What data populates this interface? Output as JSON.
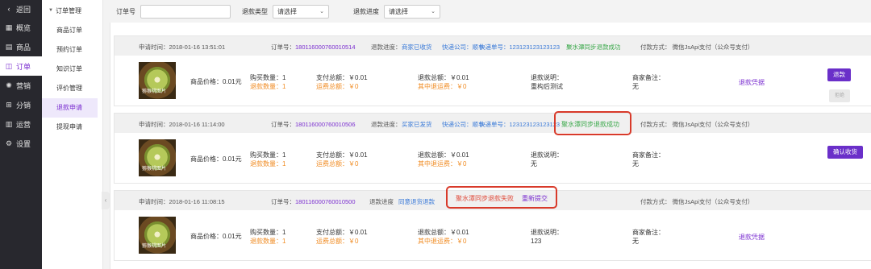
{
  "nav": {
    "back": "返回",
    "items": [
      {
        "icon": "grid-icon",
        "glyph": "▦",
        "label": "概览"
      },
      {
        "icon": "shop-icon",
        "glyph": "▤",
        "label": "商品"
      },
      {
        "icon": "order-icon",
        "glyph": "◫",
        "label": "订单"
      },
      {
        "icon": "marketing-icon",
        "glyph": "✺",
        "label": "营销"
      },
      {
        "icon": "share-icon",
        "glyph": "⊞",
        "label": "分销"
      },
      {
        "icon": "chart-icon",
        "glyph": "▥",
        "label": "运营"
      },
      {
        "icon": "settings-icon",
        "glyph": "⚙",
        "label": "设置"
      }
    ]
  },
  "subnav": {
    "title": "订单管理",
    "items": [
      "商品订单",
      "预约订单",
      "知识订单",
      "评价管理",
      "退款申请",
      "提现申请"
    ]
  },
  "filters": {
    "order_no_label": "订单号",
    "order_no_value": "",
    "type_label": "退款类型",
    "type_value": "请选择",
    "progress_label": "退款进度",
    "progress_value": "请选择"
  },
  "refunds": [
    {
      "apply_time": "申请时间：2018-01-16 13:51:01",
      "order_label": "订单号：",
      "order_no": "180116000760010514",
      "progress_label": "退款进度：",
      "progress_status": "商家已收货",
      "express_company": "快递公司：顺丰",
      "express_no": "快递单号：123123123123123",
      "sync_status": "聚水潭同步退款成功",
      "pay_method": "付款方式：  微信JsApi支付（公众号支付）",
      "price": "商品价格：0.01元",
      "buy_qty": "购买数量：1",
      "refund_qty": "退款数量：1",
      "pay_total": "支付总额：￥0.01",
      "ship_fee": "运费总额：￥0",
      "refund_total": "退款总额：￥0.01",
      "refund_ship": "其中退运费：￥0",
      "note_label": "退款说明：",
      "note": "重构后测试",
      "merchant_label": "商家备注：",
      "merchant_note": "无",
      "voucher": "退款凭据",
      "action_primary": "退款",
      "action_secondary": "拒绝"
    },
    {
      "apply_time": "申请时间：2018-01-16 11:14:00",
      "order_label": "订单号：",
      "order_no": "180116000760010506",
      "progress_label": "退款进度：",
      "progress_status": "买家已发货",
      "express_company": "快递公司：顺丰",
      "express_no": "快递单号：123123123123123",
      "sync_status": "聚水潭同步退款成功",
      "pay_method": "付款方式：  微信JsApi支付（公众号支付）",
      "price": "商品价格：0.01元",
      "buy_qty": "购买数量：1",
      "refund_qty": "退款数量：1",
      "pay_total": "支付总额：￥0.01",
      "ship_fee": "运费总额：￥0",
      "refund_total": "退款总额：￥0.01",
      "refund_ship": "其中退运费：￥0",
      "note_label": "退款说明：",
      "note": "无",
      "merchant_label": "商家备注：",
      "merchant_note": "无",
      "action_primary": "确认收货"
    },
    {
      "apply_time": "申请时间：2018-01-16 11:08:15",
      "order_label": "订单号：",
      "order_no": "180116000760010500",
      "progress_label": "退款进度",
      "progress_status": "同意退货退款",
      "sync_fail": "聚水潭同步退款失败",
      "resubmit": "重新提交",
      "pay_method": "付款方式：  微信JsApi支付（公众号支付）",
      "price": "商品价格：0.01元",
      "buy_qty": "购买数量：1",
      "refund_qty": "退款数量：1",
      "pay_total": "支付总额：￥0.01",
      "ship_fee": "运费总额：￥0",
      "refund_total": "退款总额：￥0.01",
      "refund_ship": "其中退运费：￥0",
      "note_label": "退款说明：",
      "note": "123",
      "merchant_label": "商家备注：",
      "merchant_note": "无",
      "voucher": "退款凭据"
    }
  ],
  "thumb_watermark": "猕猴桃图片",
  "colors": {
    "accent": "#7b2fd0",
    "nav_bg": "#28282e",
    "success": "#3aa84a",
    "fail": "#e04a3a",
    "highlight_box": "#d83a2a"
  }
}
